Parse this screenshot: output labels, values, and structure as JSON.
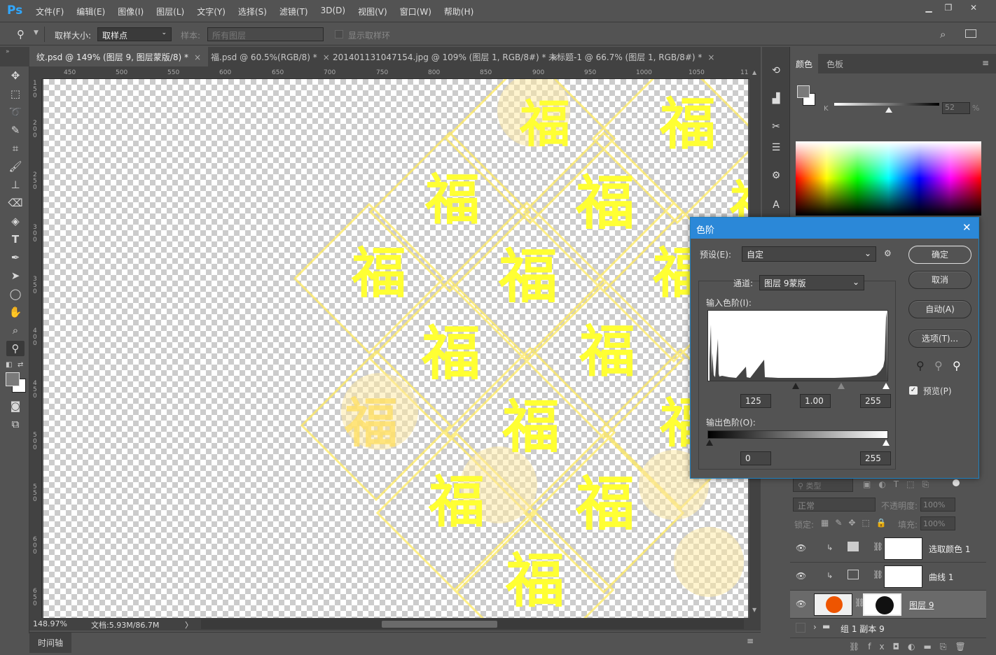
{
  "menubar": {
    "logo": "Ps",
    "items": [
      "文件(F)",
      "编辑(E)",
      "图像(I)",
      "图层(L)",
      "文字(Y)",
      "选择(S)",
      "滤镜(T)",
      "3D(D)",
      "视图(V)",
      "窗口(W)",
      "帮助(H)"
    ]
  },
  "options": {
    "sample_size_label": "取样大小:",
    "sample_size_value": "取样点",
    "sample_label": "样本:",
    "sample_value": "所有图层",
    "show_ring_label": "显示取样环"
  },
  "tabs": [
    {
      "label": "纹.psd @ 149% (图层 9, 图层蒙版/8) *",
      "close": "×"
    },
    {
      "label": "福.psd @ 60.5%(RGB/8) *",
      "close": "×"
    },
    {
      "label": "201401131047154.jpg @ 109% (图层 1, RGB/8#) *",
      "close": "×"
    },
    {
      "label": "未标题-1 @ 66.7% (图层 1, RGB/8#) *",
      "close": "×"
    }
  ],
  "ruler": {
    "h_ticks": [
      "450",
      "500",
      "550",
      "600",
      "650",
      "700",
      "750",
      "800",
      "850",
      "900",
      "950",
      "1000",
      "1050",
      "11"
    ],
    "v_ticks": [
      "1\n5\n0",
      "2\n0\n0",
      "2\n5\n0",
      "3\n0\n0",
      "3\n5\n0",
      "4\n0\n0",
      "4\n5\n0",
      "5\n0\n0",
      "5\n5\n0",
      "6\n0\n0",
      "6\n5\n0"
    ]
  },
  "canvas": {
    "glyphs": [
      "福",
      "福",
      "福",
      "福",
      "福",
      "福",
      "福",
      "福",
      "福",
      "福",
      "福",
      "福",
      "福",
      "福",
      "福",
      "福"
    ]
  },
  "status": {
    "zoom": "148.97%",
    "doc": "文档:5.93M/86.7M",
    "arrow": "〉"
  },
  "timeline": {
    "label": "时间轴"
  },
  "color_panel": {
    "tabs": [
      "颜色",
      "色板"
    ],
    "k_label": "K",
    "k_value": "52",
    "k_unit": "%",
    "k_level": 0.52
  },
  "layers_panel": {
    "filter_placeholder": "类型",
    "blend_mode": "正常",
    "opacity_label": "不透明度:",
    "opacity_value": "100%",
    "lock_label": "锁定:",
    "fill_label": "填充:",
    "fill_value": "100%",
    "layers": [
      {
        "name": "选取颜色 1"
      },
      {
        "name": "曲线 1"
      },
      {
        "name": "图层 9"
      },
      {
        "name": "组 1 副本 9"
      }
    ]
  },
  "levels_dialog": {
    "title": "色阶",
    "preset_label": "预设(E):",
    "preset_value": "自定",
    "channel_label": "通道:",
    "channel_value": "图层 9蒙版",
    "input_label": "输入色阶(I):",
    "input_black": "125",
    "input_gamma": "1.00",
    "input_white": "255",
    "output_label": "输出色阶(O):",
    "output_black": "0",
    "output_white": "255",
    "ok": "确定",
    "cancel": "取消",
    "auto": "自动(A)",
    "options": "选项(T)...",
    "preview_label": "预览(P)",
    "colors": {
      "title_bar": "#2b88d8",
      "accent": "#1e80c0"
    }
  }
}
